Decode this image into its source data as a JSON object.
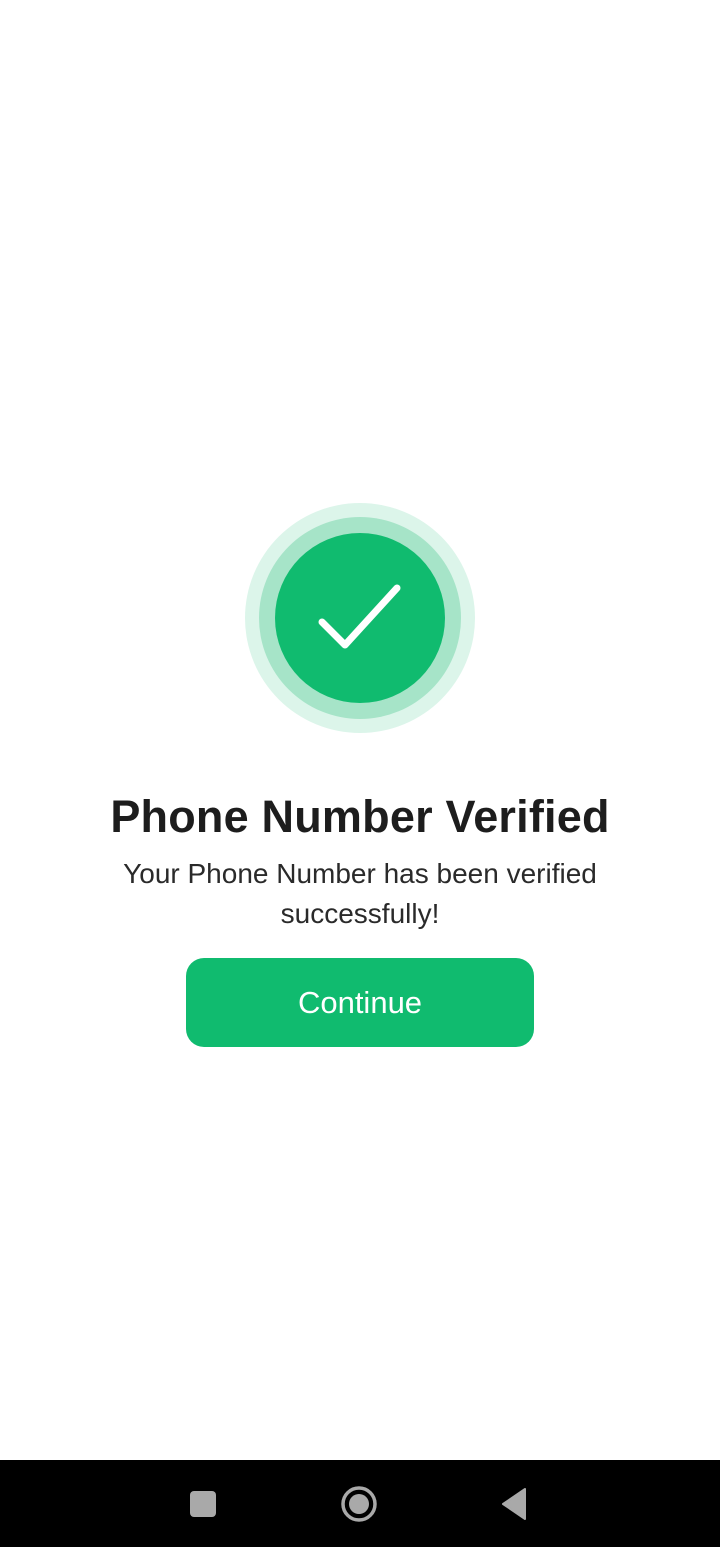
{
  "colors": {
    "accent": "#10bb6f",
    "accent_ring_inner": "#a6e4c8",
    "accent_ring_outer": "#dcf5ea",
    "title_text": "#1d1d1d",
    "body_text": "#2a2a2a",
    "button_text": "#ffffff",
    "navbar_bg": "#000000",
    "navbar_icon": "#a9a9a9"
  },
  "success": {
    "icon": "check-icon",
    "title": "Phone Number Verified",
    "message": "Your Phone Number has been verified successfully!"
  },
  "actions": {
    "continue_label": "Continue"
  },
  "system_nav": {
    "recents_icon": "square-icon",
    "home_icon": "circle-icon",
    "back_icon": "triangle-back-icon"
  }
}
